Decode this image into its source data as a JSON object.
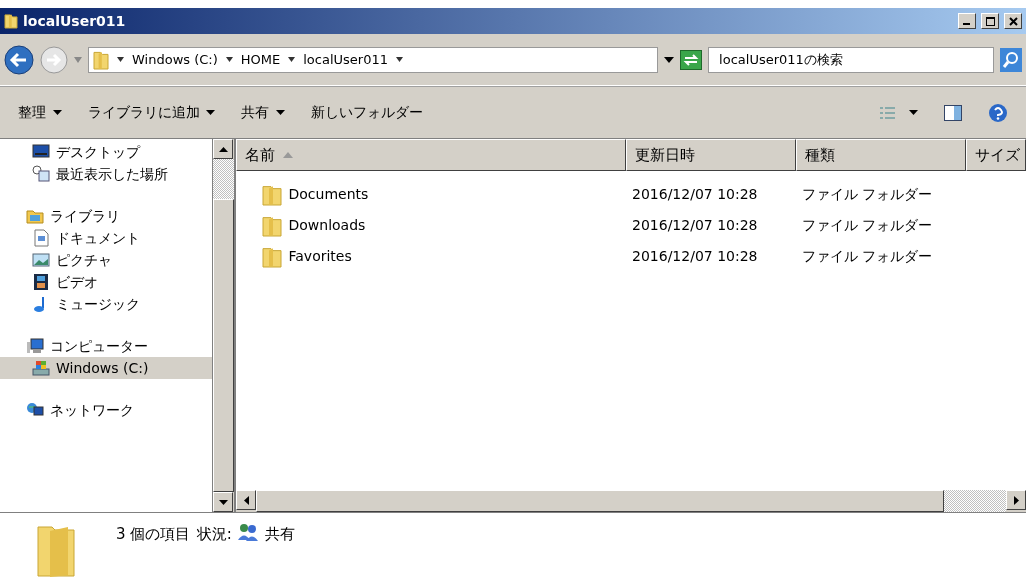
{
  "window": {
    "title": "localUser011"
  },
  "breadcrumb": [
    "Windows (C:)",
    "HOME",
    "localUser011"
  ],
  "search": {
    "placeholder": "localUser011の検索"
  },
  "toolbar": [
    {
      "label": "整理",
      "dropdown": true
    },
    {
      "label": "ライブラリに追加",
      "dropdown": true
    },
    {
      "label": "共有",
      "dropdown": true
    },
    {
      "label": "新しいフォルダー",
      "dropdown": false
    }
  ],
  "nav_pane": [
    {
      "items": [
        {
          "label": "デスクトップ",
          "kind": "desktop",
          "selected": false
        },
        {
          "label": "最近表示した場所",
          "kind": "recent",
          "selected": false
        }
      ]
    },
    {
      "label": "ライブラリ",
      "kind": "library",
      "selected": false,
      "children": [
        {
          "label": "ドキュメント",
          "kind": "document",
          "selected": false
        },
        {
          "label": "ピクチャ",
          "kind": "picture",
          "selected": false
        },
        {
          "label": "ビデオ",
          "kind": "video",
          "selected": false
        },
        {
          "label": "ミュージック",
          "kind": "music",
          "selected": false
        }
      ]
    },
    {
      "label": "コンピューター",
      "kind": "computer",
      "selected": false,
      "children": [
        {
          "label": "Windows (C:)",
          "kind": "drive",
          "selected": true
        }
      ]
    },
    {
      "label": "ネットワーク",
      "kind": "network",
      "selected": false
    }
  ],
  "table": {
    "columns": [
      {
        "label": "名前",
        "sort_ascending": true
      },
      {
        "label": "更新日時"
      },
      {
        "label": "種類"
      },
      {
        "label": "サイズ"
      }
    ],
    "rows": [
      {
        "name": "Documents",
        "modified": "2016/12/07 10:28",
        "type": "ファイル フォルダー"
      },
      {
        "name": "Downloads",
        "modified": "2016/12/07 10:28",
        "type": "ファイル フォルダー"
      },
      {
        "name": "Favorites",
        "modified": "2016/12/07 10:28",
        "type": "ファイル フォルダー"
      }
    ]
  },
  "details": {
    "count": "3 個の項目",
    "status_label": "状況:",
    "status": "共有"
  }
}
